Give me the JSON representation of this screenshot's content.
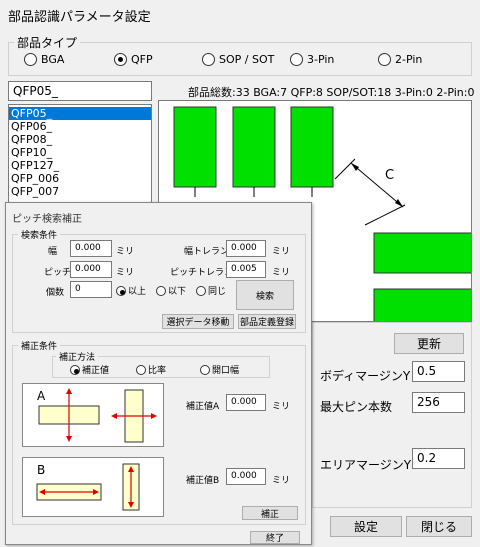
{
  "window": {
    "title": "部品認識パラメータ設定"
  },
  "part_type": {
    "label": "部品タイプ",
    "options": [
      {
        "label": "BGA",
        "selected": false
      },
      {
        "label": "QFP",
        "selected": true
      },
      {
        "label": "SOP / SOT",
        "selected": false
      },
      {
        "label": "3-Pin",
        "selected": false
      },
      {
        "label": "2-Pin",
        "selected": false
      }
    ]
  },
  "search_field": {
    "value": "QFP05_"
  },
  "summary": "部品総数:33 BGA:7 QFP:8 SOP/SOT:18 3-Pin:0 2-Pin:0",
  "part_list": [
    "QFP05_",
    "QFP06_",
    "QFP08_",
    "QFP10_",
    "QFP127_",
    "QFP_006",
    "QFP_007"
  ],
  "preview": {
    "dimension_label": "C"
  },
  "right_panel": {
    "update_button": "更新",
    "body_margin_y": {
      "label": "ボディマージンY",
      "value": "0.5"
    },
    "max_pins": {
      "label": "最大ピン本数",
      "value": "256"
    },
    "area_margin_y": {
      "label": "エリアマージンY",
      "value": "0.2"
    },
    "set_button": "設定",
    "close_button": "閉じる"
  },
  "dialog": {
    "title": "ピッチ検索補正",
    "search_conditions": {
      "label": "検索条件",
      "width": {
        "label": "幅",
        "value": "0.000",
        "unit": "ミリ"
      },
      "width_tolerance": {
        "label": "幅トレランス",
        "value": "0.000",
        "unit": "ミリ"
      },
      "pitch": {
        "label": "ピッチ",
        "value": "0.000",
        "unit": "ミリ"
      },
      "pitch_tolerance": {
        "label": "ピッチトレランス",
        "value": "0.005",
        "unit": "ミリ"
      },
      "count": {
        "label": "個数",
        "value": "0"
      },
      "count_options": [
        {
          "label": "以上",
          "selected": true
        },
        {
          "label": "以下",
          "selected": false
        },
        {
          "label": "同じ",
          "selected": false
        }
      ],
      "search_button": "検索",
      "move_selected_button": "選択データ移動",
      "register_part_button": "部品定義登録"
    },
    "correction_conditions": {
      "label": "補正条件",
      "method_label": "補正方法",
      "methods": [
        {
          "label": "補正値",
          "selected": true
        },
        {
          "label": "比率",
          "selected": false
        },
        {
          "label": "開口幅",
          "selected": false
        }
      ],
      "diagram_a_label": "A",
      "diagram_b_label": "B",
      "value_a": {
        "label": "補正値A",
        "value": "0.000",
        "unit": "ミリ"
      },
      "value_b": {
        "label": "補正値B",
        "value": "0.000",
        "unit": "ミリ"
      },
      "correct_button": "補正"
    },
    "end_button": "終了"
  },
  "colors": {
    "pad": "#00e000",
    "selection": "#0078d7",
    "arrow": "#e00000"
  }
}
